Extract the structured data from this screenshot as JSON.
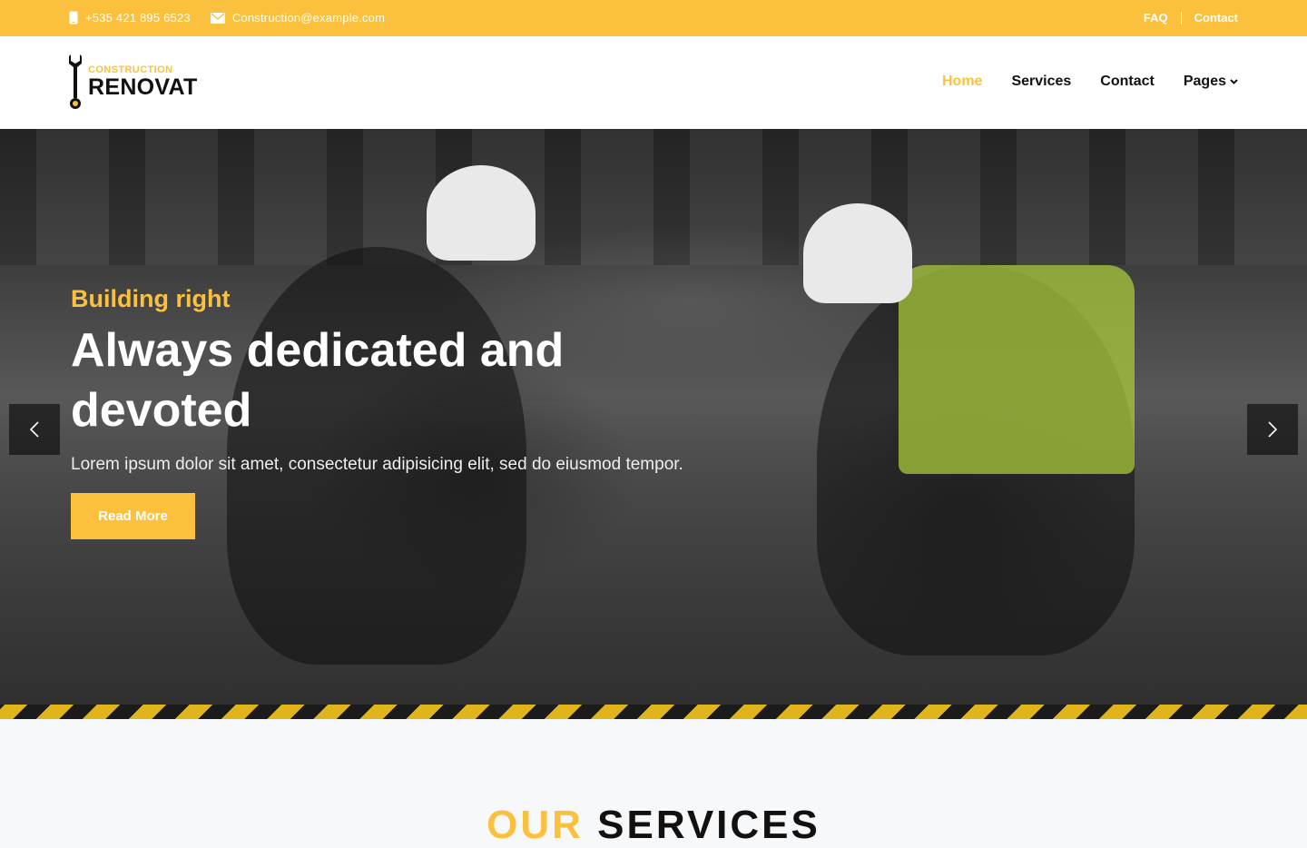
{
  "topbar": {
    "phone": "+535 421 895 6523",
    "email": "Construction@example.com",
    "links": [
      "FAQ",
      "Contact"
    ]
  },
  "brand": {
    "small": "CONSTRUCTION",
    "name": "RENOVAT"
  },
  "nav": {
    "items": [
      "Home",
      "Services",
      "Contact",
      "Pages"
    ],
    "active": "Home"
  },
  "hero": {
    "subtitle": "Building right",
    "title": "Always dedicated and devoted",
    "description": "Lorem ipsum dolor sit amet, consectetur adipisicing elit, sed do eiusmod tempor.",
    "button": "Read More"
  },
  "services": {
    "heading_accent": "OUR",
    "heading_main": "SERVICES"
  },
  "colors": {
    "accent": "#fbc13e",
    "dark": "#111111"
  },
  "icons": {
    "phone": "phone-icon",
    "email": "envelope-icon",
    "prev": "chevron-left-icon",
    "next": "chevron-right-icon",
    "dropdown": "chevron-down-icon"
  }
}
